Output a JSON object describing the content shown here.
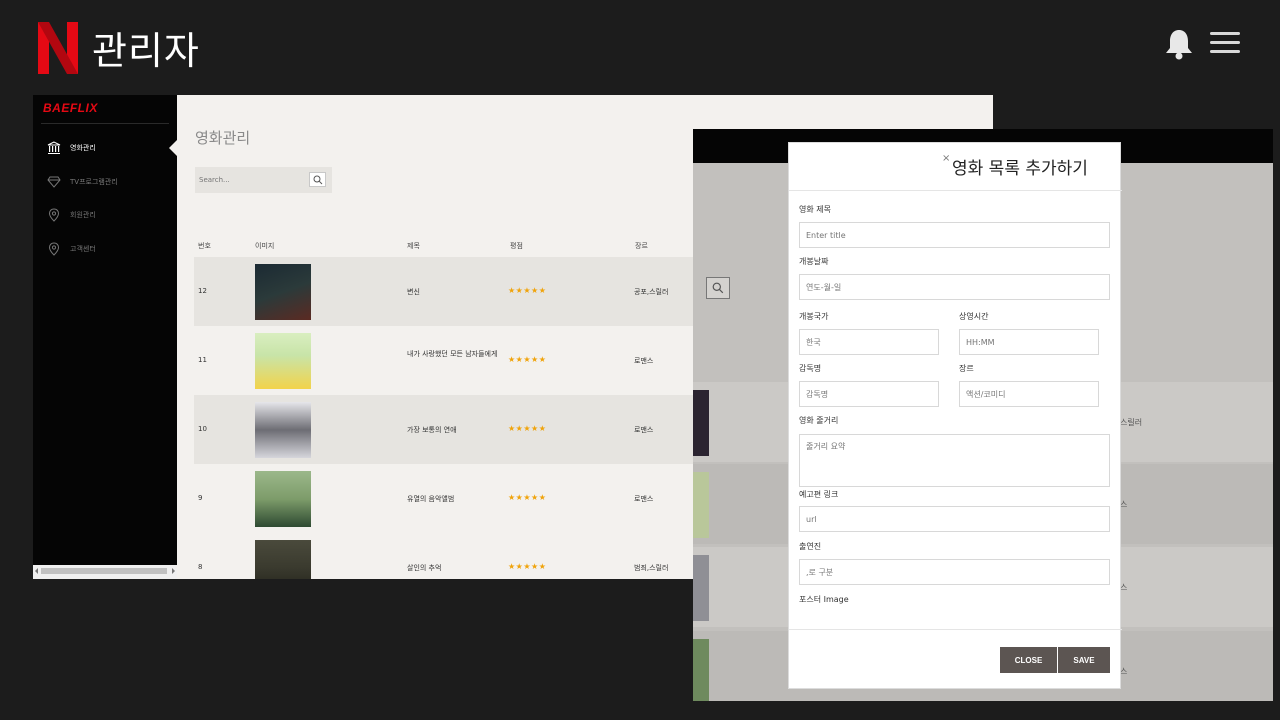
{
  "header": {
    "logo_letter": "N",
    "title": "관리자",
    "brand_color": "#e50914"
  },
  "icons": {
    "bell": "bell-icon",
    "menu": "hamburger-menu-icon"
  },
  "screen1": {
    "brand": "BAEFLIX",
    "sidebar": {
      "items": [
        {
          "label": "영화관리",
          "icon": "bank-icon",
          "active": true
        },
        {
          "label": "TV프로그램관리",
          "icon": "diamond-icon",
          "active": false
        },
        {
          "label": "회원관리",
          "icon": "location-pin-icon",
          "active": false
        },
        {
          "label": "고객센터",
          "icon": "location-pin-icon",
          "active": false
        }
      ]
    },
    "page_title": "영화관리",
    "search_placeholder": "Search...",
    "columns": [
      "번호",
      "이미지",
      "제목",
      "평점",
      "장르"
    ],
    "rows": [
      {
        "no": "12",
        "title": "변신",
        "rating": "★★★★★",
        "genre": "공포,스릴러",
        "poster_colors": [
          "#1b2a33",
          "#5b2a22"
        ]
      },
      {
        "no": "11",
        "title": "내가 사랑했던 모든 남자들에게",
        "rating": "★★★★★",
        "genre": "로맨스",
        "poster_colors": [
          "#c8e4a8",
          "#f2d34a"
        ]
      },
      {
        "no": "10",
        "title": "가장 보통의 연애",
        "rating": "★★★★★",
        "genre": "로맨스",
        "poster_colors": [
          "#d6d6dc",
          "#3a3a40"
        ]
      },
      {
        "no": "9",
        "title": "유열의 음악앨범",
        "rating": "★★★★★",
        "genre": "로맨스",
        "poster_colors": [
          "#7d9c6a",
          "#2e4a32"
        ]
      },
      {
        "no": "8",
        "title": "살인의 추억",
        "rating": "★★★★★",
        "genre": "범죄,스릴러",
        "poster_colors": [
          "#3a3a2e",
          "#1f1f18"
        ]
      }
    ]
  },
  "screen2": {
    "row_texts": [
      "스릴러",
      "스",
      "스",
      "스"
    ]
  },
  "modal": {
    "close_symbol": "×",
    "title": "영화 목록 추가하기",
    "fields": {
      "title_label": "영화 제목",
      "title_placeholder": "Enter title",
      "date_label": "개봉날짜",
      "date_placeholder": "연도-월-일",
      "country_label": "개봉국가",
      "country_placeholder": "한국",
      "runtime_label": "상영시간",
      "runtime_placeholder": "HH:MM",
      "director_label": "감독명",
      "director_placeholder": "감독명",
      "genre_label": "장르",
      "genre_placeholder": "액션/코미디",
      "plot_label": "영화 줄거리",
      "plot_placeholder": "줄거리 요약",
      "trailer_label": "예고편 링크",
      "trailer_placeholder": "url",
      "cast_label": "출연진",
      "cast_placeholder": ",로 구분",
      "poster_label": "포스터 Image"
    },
    "close_button": "CLOSE",
    "save_button": "SAVE"
  }
}
